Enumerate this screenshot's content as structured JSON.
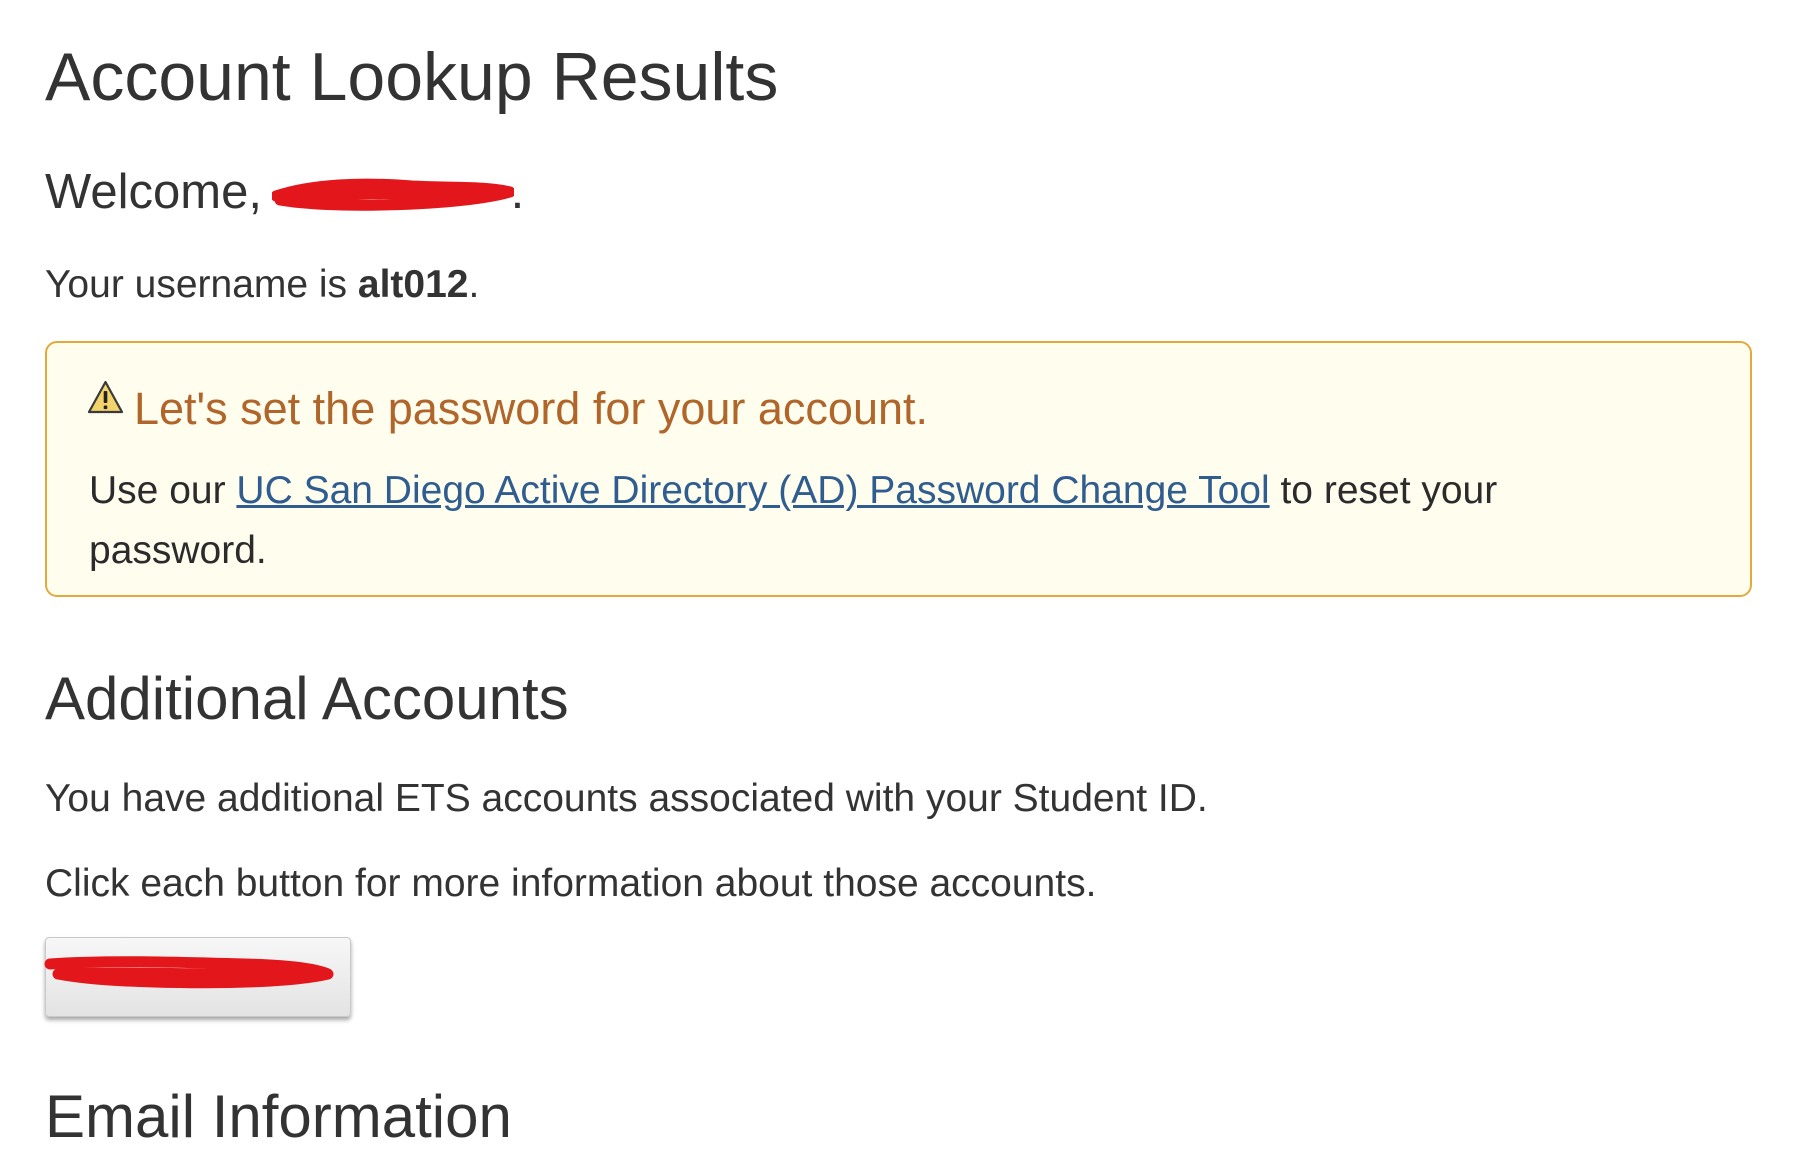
{
  "page": {
    "title": "Account Lookup Results",
    "welcome_prefix": "Welcome,",
    "welcome_suffix": ".",
    "username_prefix": "Your username is",
    "username": "alt012",
    "username_suffix": "."
  },
  "alert": {
    "icon": "warning-triangle-icon",
    "heading": "Let's set the password for your account.",
    "body_prefix": "Use our",
    "link_text": "UC San Diego Active Directory (AD) Password Change Tool",
    "body_suffix": "to reset your password.",
    "colors": {
      "border": "#e5a93a",
      "background": "#fffdee",
      "heading": "#b0662b",
      "link": "#2f5d8f"
    }
  },
  "additional_accounts": {
    "title": "Additional Accounts",
    "description": "You have additional ETS accounts associated with your Student ID.",
    "instruction": "Click each button for more information about those accounts.",
    "accounts": [
      {
        "label": ""
      }
    ]
  },
  "email_information": {
    "title": "Email Information"
  },
  "redaction_color": "#e3161b"
}
